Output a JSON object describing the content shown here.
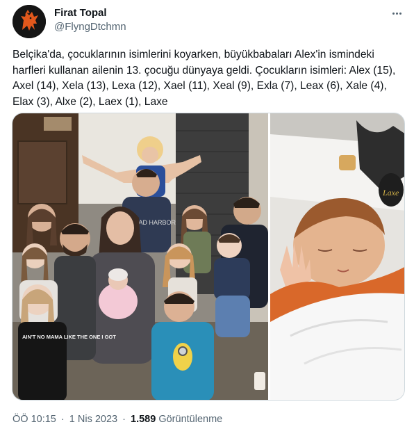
{
  "author": {
    "name": "Firat Topal",
    "handle": "@FlyngDtchmn",
    "avatar_icon": "lion-avatar-icon"
  },
  "more_icon": "more-options-icon",
  "tweet": {
    "text": "Belçika'da, çocuklarının isimlerini koyarken, büyükbabaları Alex'in ismindeki harfleri kullanan ailenin 13. çocuğu dünyaya geldi. Çocukların isimleri: Alex (15), Axel (14), Xela (13), Lexa (12), Xael (11), Xeal (9), Exla (7), Leax (6), Xale (4), Elax (3), Alxe (2), Laex (1), Laxe"
  },
  "media": {
    "left_photo": "family-group-photo",
    "right_photo": "newborn-baby-photo",
    "pillow_text": "Laxe",
    "shirt_text": "AIN'T NO MAMA LIKE THE ONE I GOT",
    "hoodie_text": "ROAD HARBOR"
  },
  "meta": {
    "time": "ÖÖ 10:15",
    "separator": "·",
    "date": "1 Nis 2023",
    "views_count": "1.589",
    "views_label": "Görüntülenme"
  },
  "colors": {
    "text_primary": "#0f1419",
    "text_secondary": "#536471",
    "border": "#cfd9de",
    "avatar_orange": "#e2581c"
  }
}
